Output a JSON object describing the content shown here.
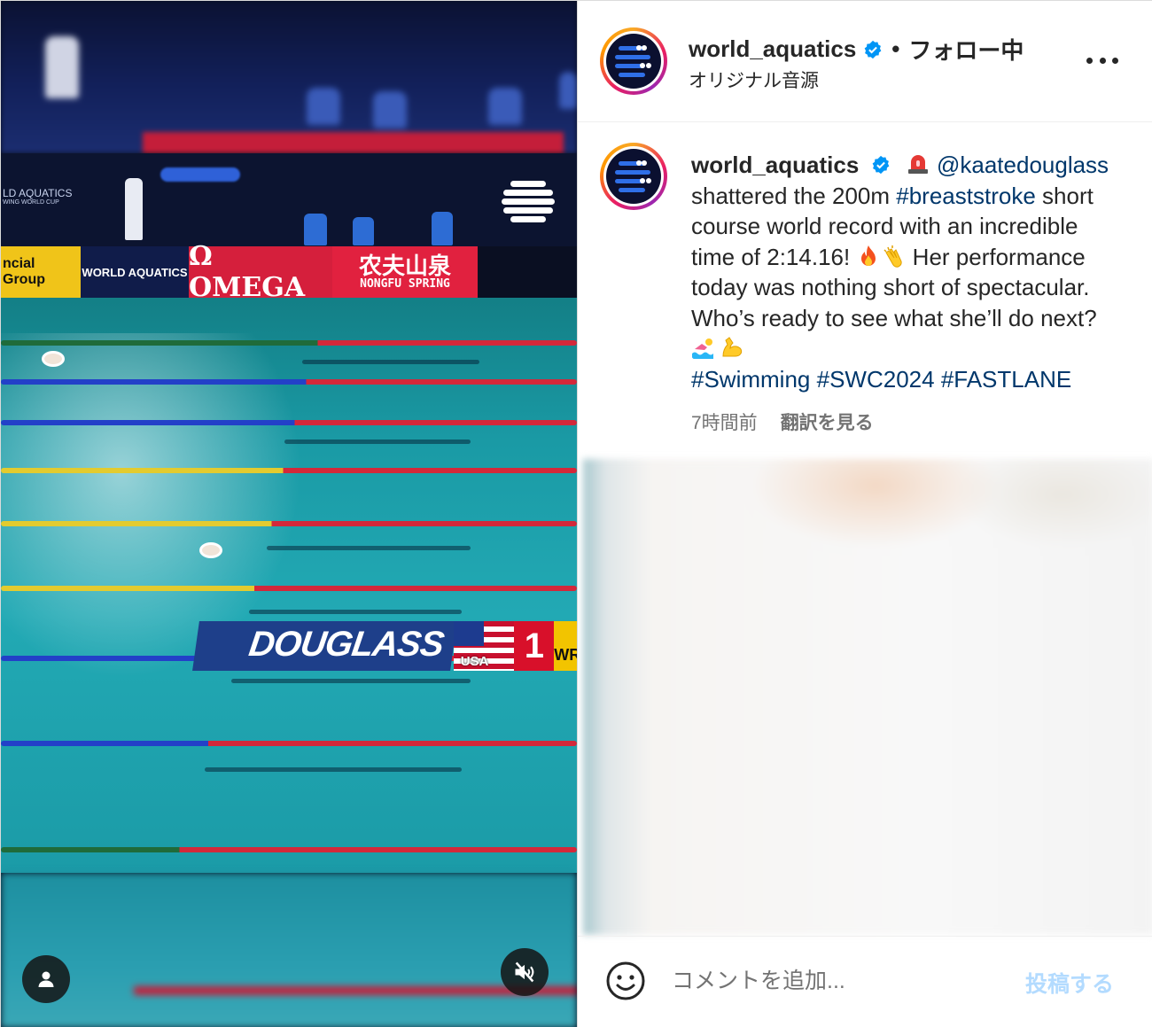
{
  "video": {
    "overlay": {
      "logo_left": "LD AQUATICS",
      "logo_left_sub": "WING WORLD CUP",
      "ads": {
        "yellow": "ncial Group",
        "world_aquatics": "WORLD AQUATICS",
        "omega": "Ω OMEGA",
        "nongfu_cn": "农夫山泉",
        "nongfu_en": "NONGFU SPRING"
      },
      "graphic": {
        "name": "DOUGLASS",
        "country": "USA",
        "rank": "1",
        "badge": "WR"
      }
    },
    "controls": {
      "user_icon": "user-icon",
      "mute_icon": "speaker-muted-icon"
    }
  },
  "header": {
    "username": "world_aquatics",
    "separator": "•",
    "follow_status": "フォロー中",
    "audio": "オリジナル音源",
    "more_icon": "more-options-icon"
  },
  "caption": {
    "username": "world_aquatics",
    "mention": "@kaatedouglass",
    "text_1": " shattered the 200m ",
    "hashtag_breaststroke": "#breaststroke",
    "text_2": " short course world record with an incredible time of 2:14.16! ",
    "text_3": " Her performance today was nothing short of spectacular. Who’s ready to see what she’ll do next? ",
    "hashtag_swimming": "#Swimming",
    "hashtag_swc": "#SWC2024",
    "hashtag_fastlane": "#FASTLANE",
    "emojis": [
      "siren-emoji",
      "fire-emoji",
      "clap-emoji",
      "swimmer-emoji",
      "muscle-emoji"
    ]
  },
  "meta": {
    "time_ago": "7時間前",
    "translate": "翻訳を見る"
  },
  "comment_bar": {
    "emoji_icon": "smiley-icon",
    "placeholder": "コメントを追加...",
    "post_label": "投稿する"
  },
  "colors": {
    "link": "#00376b",
    "verified": "#0095f6",
    "post_disabled": "#b3dbff",
    "secondary_text": "#737373"
  }
}
